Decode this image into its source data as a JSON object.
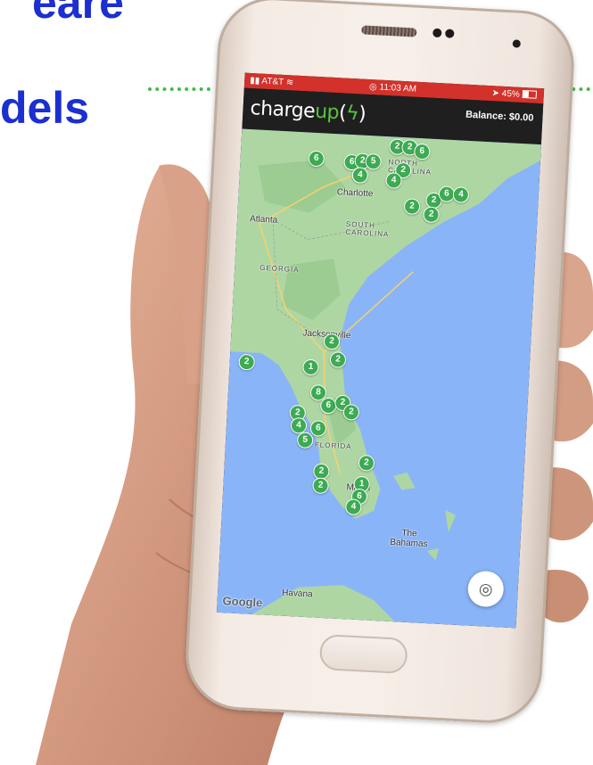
{
  "slide": {
    "title_line1": "eare",
    "title_line2": "dels"
  },
  "status_bar": {
    "carrier": "AT&T",
    "time": "11:03 AM",
    "battery": "45%"
  },
  "header": {
    "logo_main": "charge",
    "logo_accent": "up",
    "balance": "Balance: $0.00"
  },
  "map": {
    "labels": {
      "charlotte": "Charlotte",
      "atlanta": "Atlanta",
      "south_carolina": "SOUTH\nCAROLINA",
      "georgia": "GEORGIA",
      "jacksonville": "Jacksonville",
      "florida": "FLORIDA",
      "miami": "Miami",
      "bahamas": "The\nBahamas",
      "havana": "Havana",
      "north_carolina": "NORTH\nCAROLINA"
    },
    "pins": [
      "6",
      "6",
      "2",
      "5",
      "4",
      "2",
      "2",
      "6",
      "2",
      "4",
      "2",
      "6",
      "4",
      "2",
      "2",
      "2",
      "2",
      "1",
      "8",
      "2",
      "6",
      "2",
      "2",
      "4",
      "6",
      "5",
      "2",
      "2",
      "2",
      "1",
      "6",
      "4",
      "2"
    ],
    "attribution": "Google"
  },
  "colors": {
    "title": "#1c2fd0",
    "status_bar": "#d2322b",
    "pin": "#3cab52",
    "water": "#8ab4f8",
    "land": "#aed6a3"
  },
  "icons": {
    "locate": "crosshair-icon",
    "signal": "signal-icon",
    "wifi": "wifi-icon",
    "battery": "battery-icon",
    "bolt": "lightning-bolt-icon"
  }
}
